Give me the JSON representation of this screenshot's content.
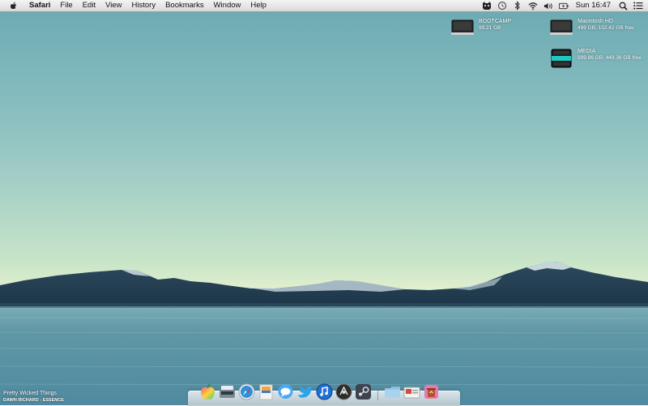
{
  "menubar": {
    "app_name": "Safari",
    "menus": [
      "File",
      "Edit",
      "View",
      "History",
      "Bookmarks",
      "Window",
      "Help"
    ],
    "clock": "Sun 16:47",
    "status_icons": [
      "growl-icon",
      "time-machine-icon",
      "bluetooth-icon",
      "wifi-icon",
      "volume-icon",
      "battery-icon",
      "spotlight-icon",
      "notification-list-icon"
    ]
  },
  "desktop": {
    "disks": [
      {
        "name": "BOOTCAMP",
        "info": "99.21 GB"
      },
      {
        "name": "Macintosh HD",
        "info": "499 GB, 152.42 GB free"
      },
      {
        "name": "MEDIA",
        "info": "999.86 GB, 449.36 GB free"
      }
    ]
  },
  "now_playing": {
    "title": "Pretty Wicked Things",
    "artist": "DAWN RICHARD - ESSENCE"
  },
  "dock": {
    "apps": [
      "finder-app",
      "scanner-app",
      "safari-app",
      "preview-app",
      "messages-app",
      "twitter-app",
      "itunes-app",
      "alfred-app",
      "steam-app"
    ],
    "others": [
      "folder-stack",
      "downloads-stack",
      "trash"
    ]
  },
  "colors": {
    "sky_top": "#6aa9b2",
    "horizon": "#e3f0cf",
    "water": "#5f97a6"
  }
}
